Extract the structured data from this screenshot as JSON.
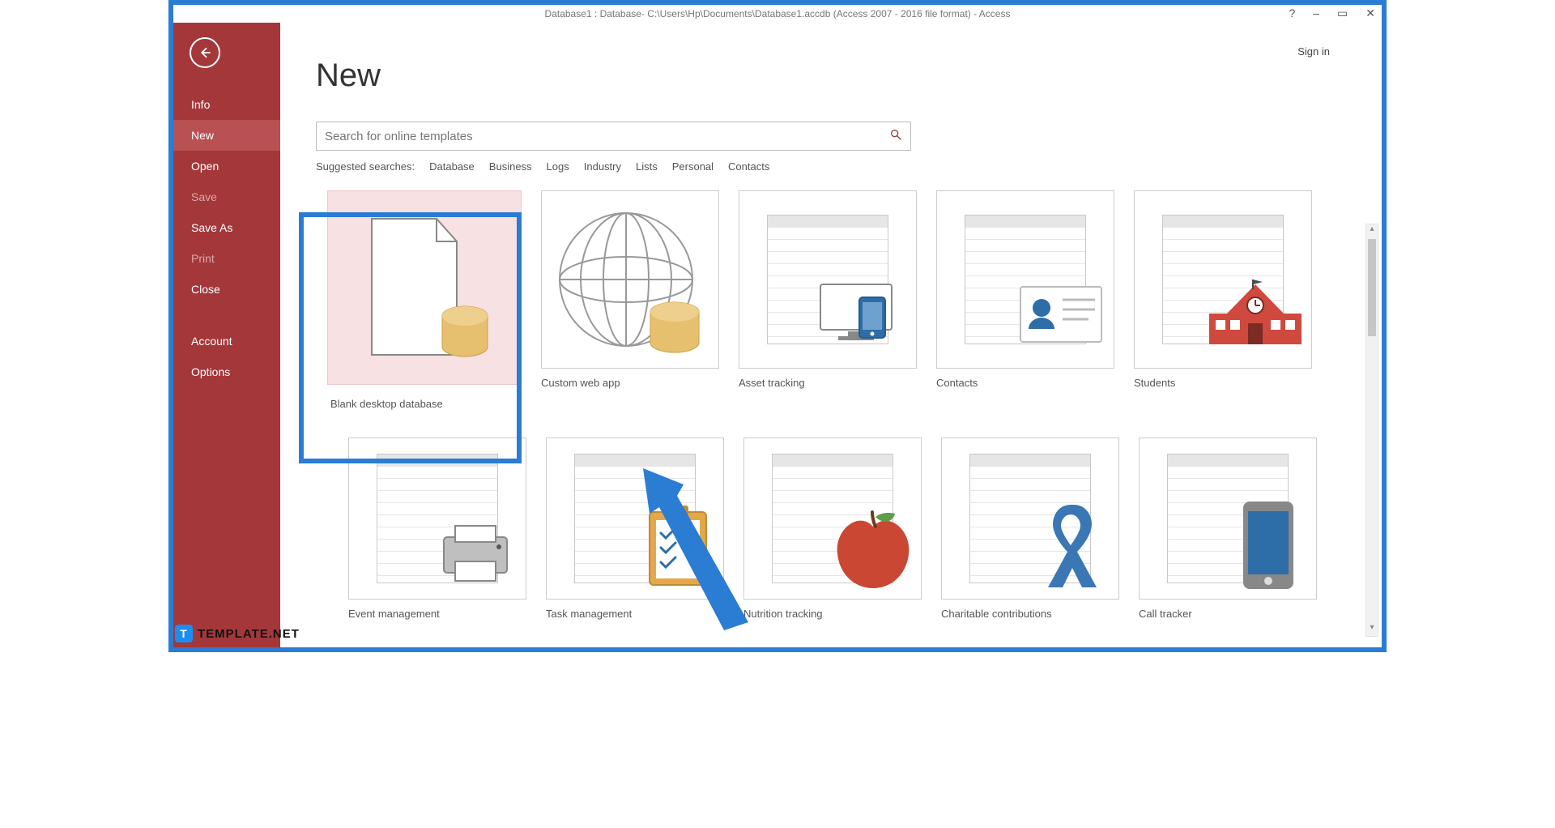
{
  "titlebar": {
    "text": "Database1 : Database- C:\\Users\\Hp\\Documents\\Database1.accdb (Access 2007 - 2016 file format) - Access",
    "help": "?",
    "minimize": "–",
    "restore": "▭",
    "close": "✕"
  },
  "signin": "Sign in",
  "sidebar": {
    "items": [
      {
        "label": "Info",
        "disabled": false
      },
      {
        "label": "New",
        "disabled": false,
        "active": true
      },
      {
        "label": "Open",
        "disabled": false
      },
      {
        "label": "Save",
        "disabled": true
      },
      {
        "label": "Save As",
        "disabled": false
      },
      {
        "label": "Print",
        "disabled": true
      },
      {
        "label": "Close",
        "disabled": false
      }
    ],
    "footer": [
      {
        "label": "Account"
      },
      {
        "label": "Options"
      }
    ]
  },
  "page": {
    "title": "New",
    "search_placeholder": "Search for online templates",
    "suggested_label": "Suggested searches:",
    "suggested": [
      "Database",
      "Business",
      "Logs",
      "Industry",
      "Lists",
      "Personal",
      "Contacts"
    ]
  },
  "templates": [
    {
      "label": "Blank desktop database",
      "icon": "doc-db",
      "selected": true
    },
    {
      "label": "Custom web app",
      "icon": "globe-db"
    },
    {
      "label": "Asset tracking",
      "icon": "asset"
    },
    {
      "label": "Contacts",
      "icon": "contact"
    },
    {
      "label": "Students",
      "icon": "school"
    },
    {
      "label": "Event management",
      "icon": "fax"
    },
    {
      "label": "Task management",
      "icon": "clipboard"
    },
    {
      "label": "Nutrition tracking",
      "icon": "apple"
    },
    {
      "label": "Charitable contributions",
      "icon": "ribbon"
    },
    {
      "label": "Call tracker",
      "icon": "phone"
    }
  ],
  "watermark": {
    "badge": "T",
    "text": "TEMPLATE.NET"
  },
  "colors": {
    "accent": "#a4373a",
    "frame": "#2b7cd3"
  }
}
